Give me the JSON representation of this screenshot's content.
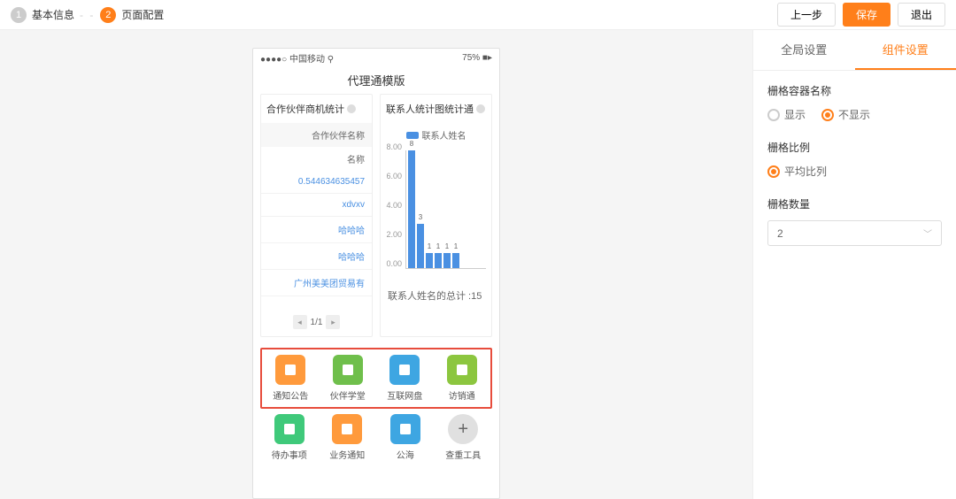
{
  "header": {
    "step1_num": "1",
    "step1_label": "基本信息",
    "step2_num": "2",
    "step2_label": "页面配置",
    "btn_prev": "上一步",
    "btn_save": "保存",
    "btn_exit": "退出"
  },
  "phone": {
    "carrier": "●●●●○ 中国移动 ⚲",
    "battery": "75% ■▸",
    "title": "代理通模版",
    "card1_title": "合作伙伴商机统计",
    "card2_title": "联系人统计图统计通",
    "table": {
      "header1": "合作伙伴名称",
      "header2": "名称",
      "rows": [
        "0.544634635457",
        "xdvxv",
        "哈哈哈",
        "哈哈哈",
        "广州美美团贸易有"
      ],
      "pager": "1/1"
    },
    "chart_footer": "联系人姓名的总计 :15"
  },
  "chart_data": {
    "type": "bar",
    "title": "",
    "xlabel": "",
    "ylabel": "",
    "ylim": [
      0,
      8
    ],
    "y_ticks": [
      "8.00",
      "6.00",
      "4.00",
      "2.00",
      "0.00"
    ],
    "legend": "联系人姓名",
    "categories": [
      "",
      "",
      "",
      "",
      "",
      ""
    ],
    "values": [
      8,
      3,
      1,
      1,
      1,
      1
    ],
    "value_labels": [
      "8",
      "3",
      "1",
      "1",
      "1",
      "1"
    ]
  },
  "apps": {
    "row1": [
      {
        "label": "通知公告",
        "color": "#ff9a3c"
      },
      {
        "label": "伙伴学堂",
        "color": "#6fbf4b"
      },
      {
        "label": "互联网盘",
        "color": "#3ea6e2"
      },
      {
        "label": "访销通",
        "color": "#8cc63f"
      }
    ],
    "row2": [
      {
        "label": "待办事项",
        "color": "#3fc97a"
      },
      {
        "label": "业务通知",
        "color": "#ff9a3c"
      },
      {
        "label": "公海",
        "color": "#3ea6e2"
      },
      {
        "label": "查重工具",
        "color": "#e0e0e0"
      }
    ]
  },
  "sidebar": {
    "tab_global": "全局设置",
    "tab_component": "组件设置",
    "field1_label": "栅格容器名称",
    "opt_show": "显示",
    "opt_hide": "不显示",
    "field2_label": "栅格比例",
    "opt_avg": "平均比列",
    "field3_label": "栅格数量",
    "select_value": "2"
  }
}
